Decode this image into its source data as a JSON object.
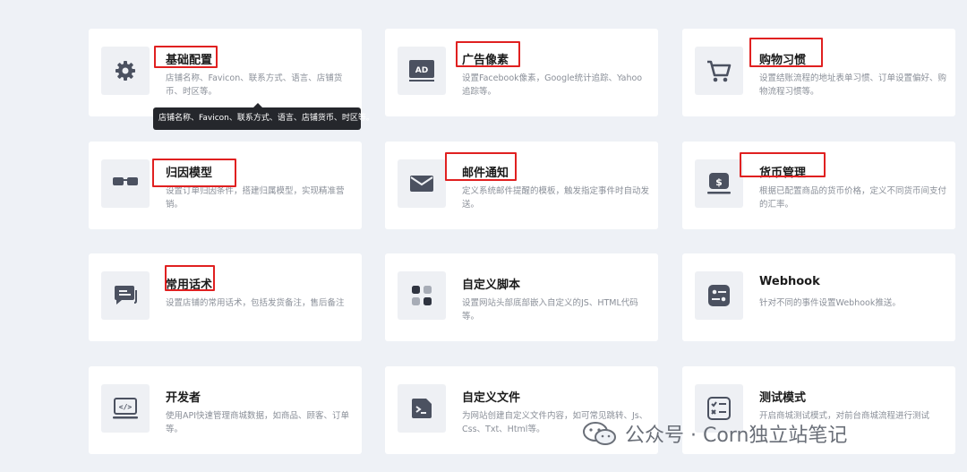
{
  "cards": [
    {
      "title": "基础配置",
      "desc": "店铺名称、Favicon、联系方式、语言、店铺货币、时区等。",
      "icon": "gear-icon"
    },
    {
      "title": "广告像素",
      "desc": "设置Facebook像素，Google统计追踪、Yahoo追踪等。",
      "icon": "ad-icon"
    },
    {
      "title": "购物习惯",
      "desc": "设置结账流程的地址表单习惯、订单设置偏好、购物流程习惯等。",
      "icon": "cart-icon"
    },
    {
      "title": "归因模型",
      "desc": "设置订单归因条件，搭建归属模型，实现精准营销。",
      "icon": "glasses-icon"
    },
    {
      "title": "邮件通知",
      "desc": "定义系统邮件提醒的模板，触发指定事件时自动发送。",
      "icon": "mail-icon"
    },
    {
      "title": "货币管理",
      "desc": "根据已配置商品的货币价格，定义不同货币间支付的汇率。",
      "icon": "currency-icon"
    },
    {
      "title": "常用话术",
      "desc": "设置店铺的常用话术，包括发货备注，售后备注",
      "icon": "chat-icon"
    },
    {
      "title": "自定义脚本",
      "desc": "设置网站头部底部嵌入自定义的JS、HTML代码等。",
      "icon": "apps-icon"
    },
    {
      "title": "Webhook",
      "desc": "针对不同的事件设置Webhook推送。",
      "icon": "sliders-icon"
    },
    {
      "title": "开发者",
      "desc": "使用API快速管理商城数据，如商品、顾客、订单等。",
      "icon": "code-icon"
    },
    {
      "title": "自定义文件",
      "desc": "为网站创建自定义文件内容，如可常见跳转、Js、Css、Txt、Html等。",
      "icon": "terminal-icon"
    },
    {
      "title": "测试模式",
      "desc": "开启商城测试模式，对前台商城流程进行测试",
      "icon": "checklist-icon"
    }
  ],
  "tooltip": {
    "text": "店铺名称、Favicon、联系方式、语言、店铺货币、时区等。"
  },
  "watermark": {
    "text": "公众号 · Corn独立站笔记"
  },
  "colors": {
    "highlight": "#e02020",
    "icon": "#4b5160",
    "background": "#eef1f6"
  }
}
